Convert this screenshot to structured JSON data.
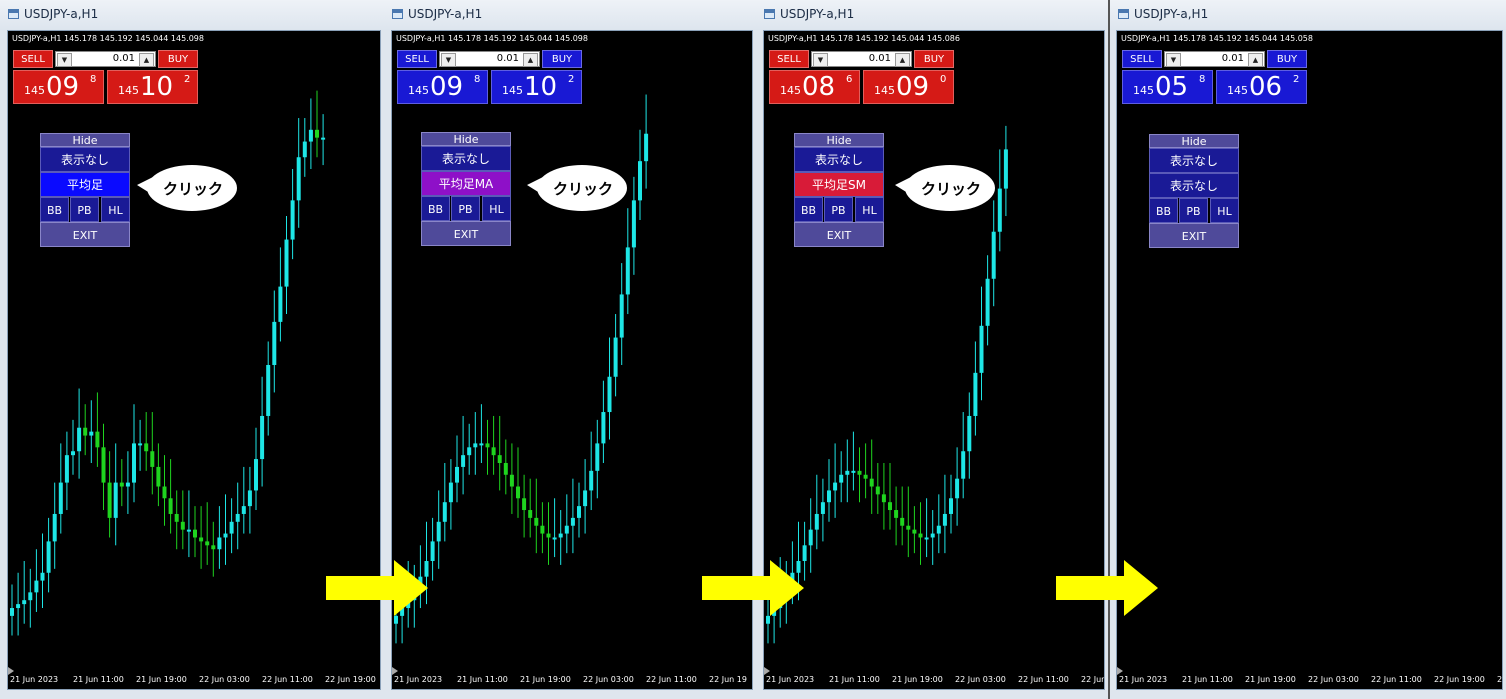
{
  "colors": {
    "sell_red": "#d51a16",
    "buy_blue": "#1919d4",
    "bull": "#1ee6e6",
    "bear": "#1fd41f",
    "heiashi_active": "#0a0aff",
    "ma_active": "#8e10c8",
    "sm_active": "#d81b38",
    "arrow": "#ffff00"
  },
  "panels": [
    {
      "title": "USDJPY-a,H1",
      "info": "USDJPY-a,H1  145.178 145.192 145.044 145.098",
      "theme": "red",
      "sell_label": "SELL",
      "buy_label": "BUY",
      "lot": "0.01",
      "bid": {
        "small": "145",
        "big": "09",
        "sup": "8"
      },
      "ask": {
        "small": "145",
        "big": "10",
        "sup": "2"
      },
      "hide_label": "Hide",
      "row1_label": "表示なし",
      "row2_label": "平均足",
      "row2_style": "heiashi",
      "bb_label": "BB",
      "pb_label": "PB",
      "hl_label": "HL",
      "exit_label": "EXIT",
      "callout_text": "クリック",
      "dates": [
        "21 Jun 2023",
        "21 Jun 11:00",
        "21 Jun 19:00",
        "22 Jun 03:00",
        "22 Jun 11:00",
        "22 Jun 19:00"
      ]
    },
    {
      "title": "USDJPY-a,H1",
      "info": "USDJPY-a,H1  145.178 145.192 145.044 145.098",
      "theme": "blue",
      "sell_label": "SELL",
      "buy_label": "BUY",
      "lot": "0.01",
      "bid": {
        "small": "145",
        "big": "09",
        "sup": "8"
      },
      "ask": {
        "small": "145",
        "big": "10",
        "sup": "2"
      },
      "hide_label": "Hide",
      "row1_label": "表示なし",
      "row2_label": "平均足MA",
      "row2_style": "ma",
      "bb_label": "BB",
      "pb_label": "PB",
      "hl_label": "HL",
      "exit_label": "EXIT",
      "callout_text": "クリック",
      "dates": [
        "21 Jun 2023",
        "21 Jun 11:00",
        "21 Jun 19:00",
        "22 Jun 03:00",
        "22 Jun 11:00",
        "22 Jun 19"
      ]
    },
    {
      "title": "USDJPY-a,H1",
      "info": "USDJPY-a,H1  145.178 145.192 145.044 145.086",
      "theme": "red",
      "sell_label": "SELL",
      "buy_label": "BUY",
      "lot": "0.01",
      "bid": {
        "small": "145",
        "big": "08",
        "sup": "6"
      },
      "ask": {
        "small": "145",
        "big": "09",
        "sup": "0"
      },
      "hide_label": "Hide",
      "row1_label": "表示なし",
      "row2_label": "平均足SM",
      "row2_style": "sm",
      "bb_label": "BB",
      "pb_label": "PB",
      "hl_label": "HL",
      "exit_label": "EXIT",
      "callout_text": "クリック",
      "dates": [
        "21 Jun 2023",
        "21 Jun 11:00",
        "21 Jun 19:00",
        "22 Jun 03:00",
        "22 Jun 11:00",
        "22 Jun 19:00",
        "22 Ju"
      ]
    },
    {
      "title": "USDJPY-a,H1",
      "info": "USDJPY-a,H1  145.178 145.192 145.044 145.058",
      "theme": "blue",
      "sell_label": "SELL",
      "buy_label": "BUY",
      "lot": "0.01",
      "bid": {
        "small": "145",
        "big": "05",
        "sup": "8"
      },
      "ask": {
        "small": "145",
        "big": "06",
        "sup": "2"
      },
      "hide_label": "Hide",
      "row1_label": "表示なし",
      "row2_label": "表示なし",
      "row2_style": "plain",
      "bb_label": "BB",
      "pb_label": "PB",
      "hl_label": "HL",
      "exit_label": "EXIT",
      "callout_text": "",
      "dates": [
        "21 Jun 2023",
        "21 Jun 11:00",
        "21 Jun 19:00",
        "22 Jun 03:00",
        "22 Jun 11:00",
        "22 Jun 19:00",
        "2"
      ]
    }
  ],
  "chart_data": [
    {
      "type": "candlestick",
      "indicator": "heikin-ashi",
      "x": [
        "21 Jun 2023",
        "21 Jun 11:00",
        "21 Jun 19:00",
        "22 Jun 03:00",
        "22 Jun 11:00",
        "22 Jun 19:00"
      ],
      "close_series": [
        143.88,
        143.89,
        143.9,
        143.92,
        143.95,
        143.97,
        144.05,
        144.12,
        144.2,
        144.27,
        144.28,
        144.34,
        144.32,
        144.33,
        144.29,
        144.2,
        144.11,
        144.2,
        144.19,
        144.2,
        144.3,
        144.3,
        144.28,
        144.24,
        144.19,
        144.16,
        144.12,
        144.1,
        144.08,
        144.08,
        144.06,
        144.05,
        144.04,
        144.03,
        144.06,
        144.07,
        144.1,
        144.12,
        144.14,
        144.18,
        144.26,
        144.37,
        144.5,
        144.61,
        144.7,
        144.82,
        144.92,
        145.03,
        145.07,
        145.1,
        145.08,
        145.08
      ]
    },
    {
      "type": "candlestick",
      "indicator": "heikin-ashi MA",
      "x": [
        "21 Jun 2023",
        "21 Jun 11:00",
        "21 Jun 19:00",
        "22 Jun 03:00",
        "22 Jun 11:00",
        "22 Jun 19"
      ],
      "close_series": [
        143.86,
        143.88,
        143.9,
        143.93,
        143.96,
        144.0,
        144.05,
        144.1,
        144.15,
        144.2,
        144.24,
        144.27,
        144.29,
        144.3,
        144.3,
        144.29,
        144.27,
        144.25,
        144.22,
        144.19,
        144.16,
        144.13,
        144.11,
        144.09,
        144.07,
        144.06,
        144.06,
        144.07,
        144.09,
        144.11,
        144.14,
        144.18,
        144.23,
        144.3,
        144.38,
        144.47,
        144.57,
        144.68,
        144.8,
        144.92,
        145.02,
        145.09
      ]
    },
    {
      "type": "candlestick",
      "indicator": "heikin-ashi SM",
      "x": [
        "21 Jun 2023",
        "21 Jun 11:00",
        "21 Jun 19:00",
        "22 Jun 03:00",
        "22 Jun 11:00",
        "22 Jun 19:00"
      ],
      "close_series": [
        143.86,
        143.88,
        143.91,
        143.94,
        143.97,
        144.0,
        144.04,
        144.08,
        144.12,
        144.15,
        144.18,
        144.2,
        144.22,
        144.23,
        144.23,
        144.22,
        144.21,
        144.19,
        144.17,
        144.15,
        144.13,
        144.11,
        144.09,
        144.08,
        144.07,
        144.06,
        144.06,
        144.07,
        144.09,
        144.12,
        144.16,
        144.21,
        144.28,
        144.37,
        144.48,
        144.6,
        144.72,
        144.84,
        144.95,
        145.05
      ]
    },
    {
      "type": "candlestick",
      "indicator": "none",
      "x": [
        "21 Jun 2023",
        "21 Jun 11:00",
        "21 Jun 19:00",
        "22 Jun 03:00",
        "22 Jun 11:00",
        "22 Jun 19:00"
      ],
      "close_series": []
    }
  ]
}
